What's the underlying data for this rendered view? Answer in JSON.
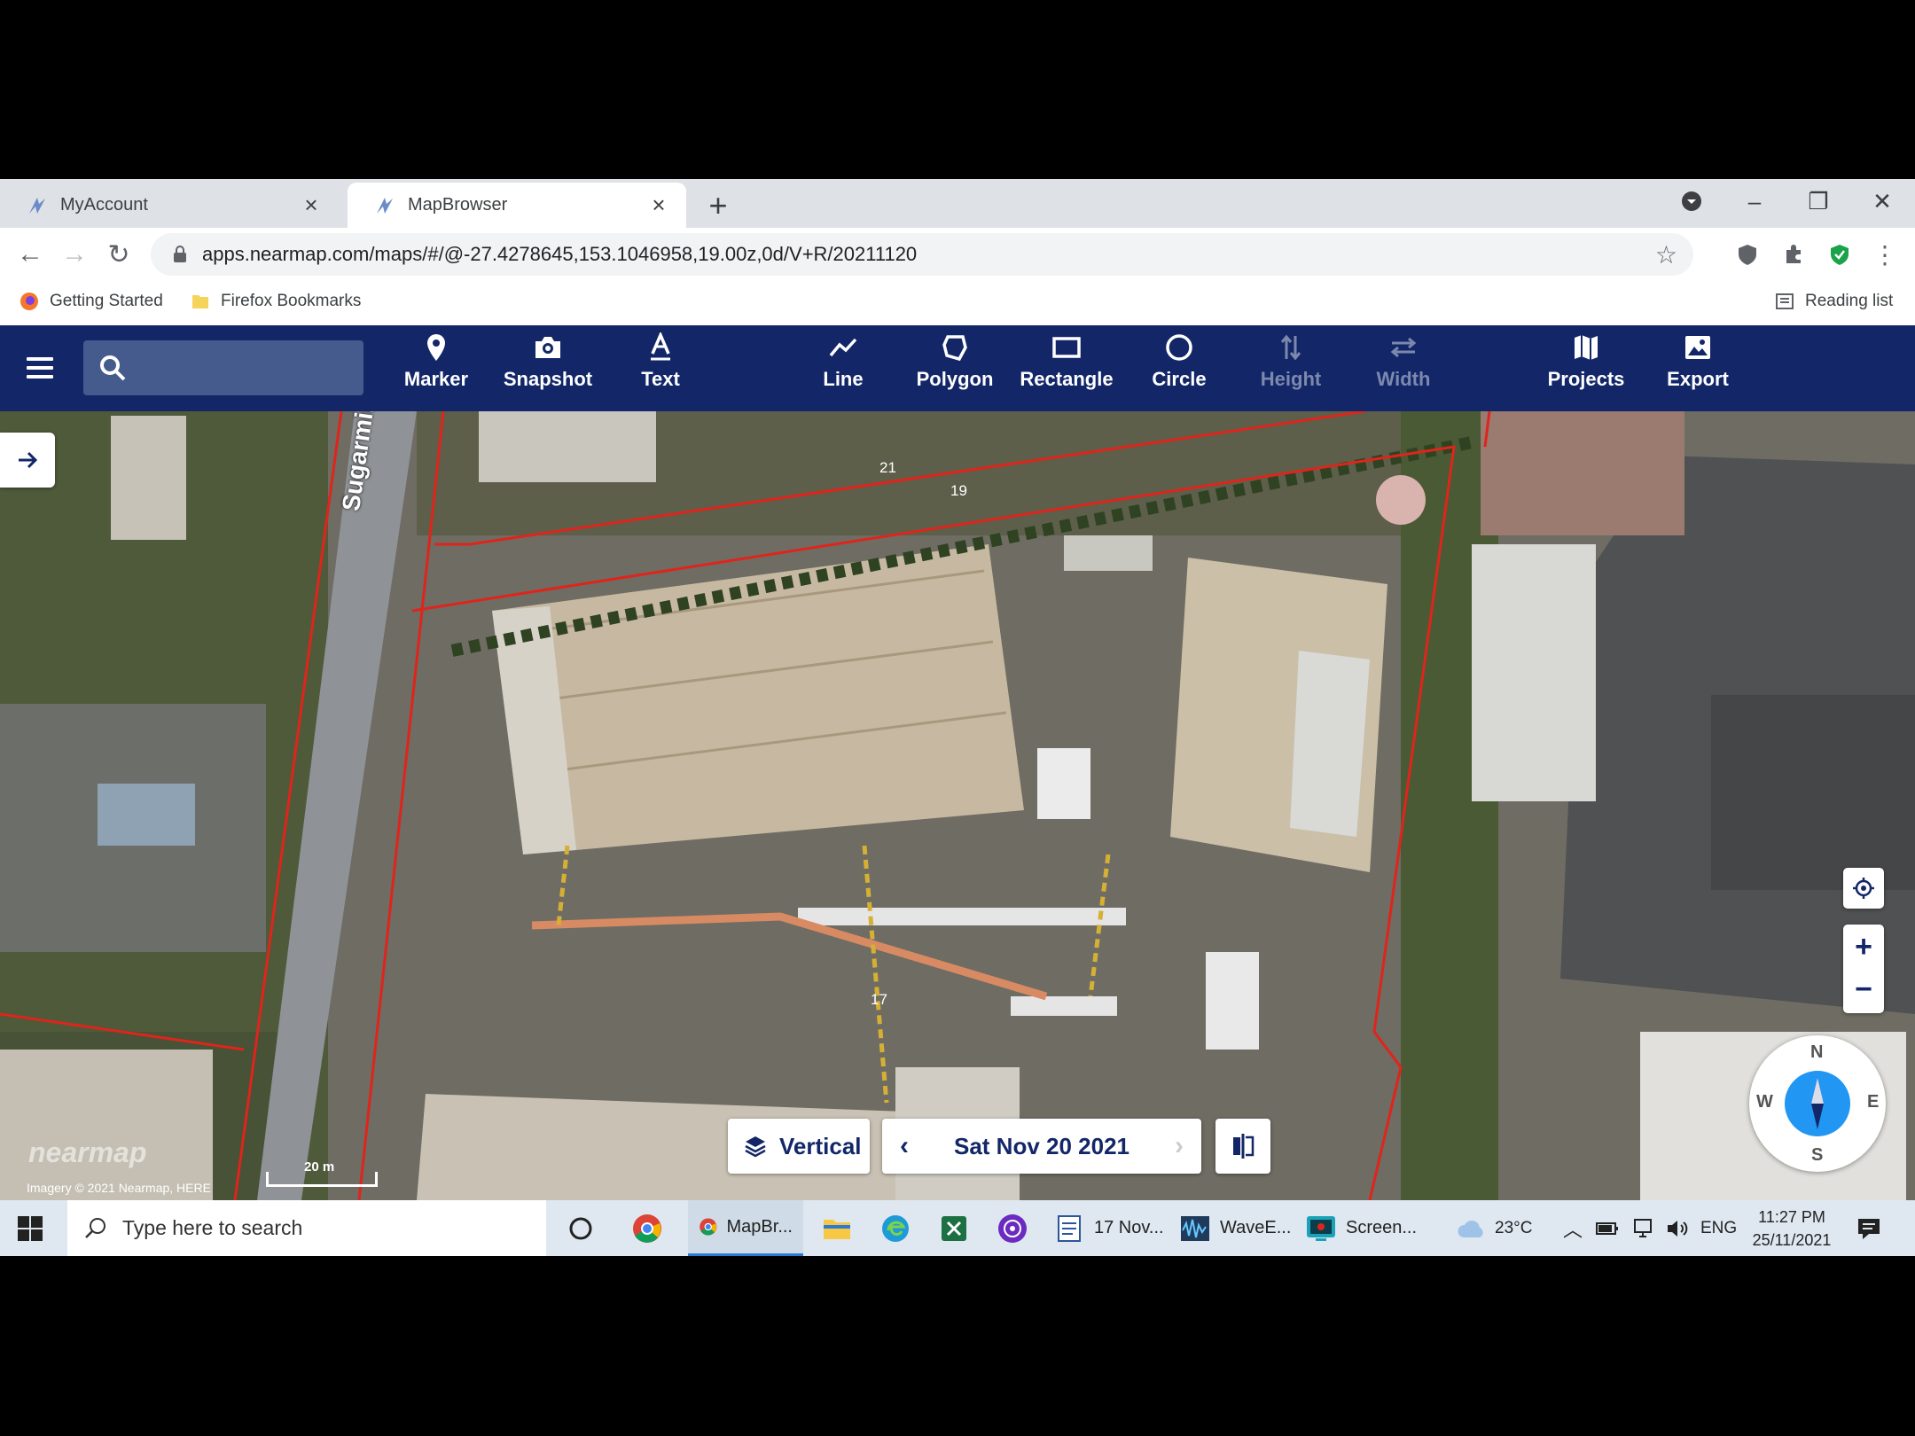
{
  "browser": {
    "tabs": [
      {
        "title": "MyAccount",
        "active": false
      },
      {
        "title": "MapBrowser",
        "active": true
      }
    ],
    "url": "apps.nearmap.com/maps/#/@-27.4278645,153.1046958,19.00z,0d/V+R/20211120",
    "bookmarks": [
      "Getting Started",
      "Firefox Bookmarks"
    ],
    "reading_list": "Reading list"
  },
  "toolbar": {
    "search_placeholder": "",
    "tools_left": [
      {
        "label": "Marker",
        "icon": "marker-icon"
      },
      {
        "label": "Snapshot",
        "icon": "camera-icon"
      },
      {
        "label": "Text",
        "icon": "text-icon"
      }
    ],
    "tools_mid": [
      {
        "label": "Line",
        "icon": "line-icon"
      },
      {
        "label": "Polygon",
        "icon": "polygon-icon"
      },
      {
        "label": "Rectangle",
        "icon": "rectangle-icon"
      },
      {
        "label": "Circle",
        "icon": "circle-icon"
      },
      {
        "label": "Height",
        "icon": "height-icon",
        "disabled": true
      },
      {
        "label": "Width",
        "icon": "width-icon",
        "disabled": true
      }
    ],
    "tools_right": [
      {
        "label": "Projects",
        "icon": "map-icon"
      },
      {
        "label": "Export",
        "icon": "image-icon"
      }
    ]
  },
  "map": {
    "street_label": "Sugarmill Rd",
    "lot_numbers": [
      "21",
      "19",
      "17"
    ],
    "view_mode": "Vertical",
    "date": "Sat Nov 20 2021",
    "watermark": "nearmap",
    "attribution": "Imagery © 2021 Nearmap, HERE",
    "scale_label": "20 m",
    "compass": {
      "n": "N",
      "e": "E",
      "s": "S",
      "w": "W"
    },
    "zoom_in": "+",
    "zoom_out": "−"
  },
  "taskbar": {
    "search_placeholder": "Type here to search",
    "apps": [
      {
        "label": "MapBr...",
        "icon": "chrome-icon"
      },
      {
        "label": "17 Nov...",
        "icon": "word-icon"
      },
      {
        "label": "WaveE...",
        "icon": "wave-icon"
      },
      {
        "label": "Screen...",
        "icon": "screen-recorder-icon"
      }
    ],
    "weather": "23°C",
    "language": "ENG",
    "time": "11:27 PM",
    "date": "25/11/2021"
  },
  "colors": {
    "toolbar_bg": "#132768",
    "search_bg": "#455a8d",
    "boundary": "#e0241b",
    "compass": "#2196f3"
  }
}
